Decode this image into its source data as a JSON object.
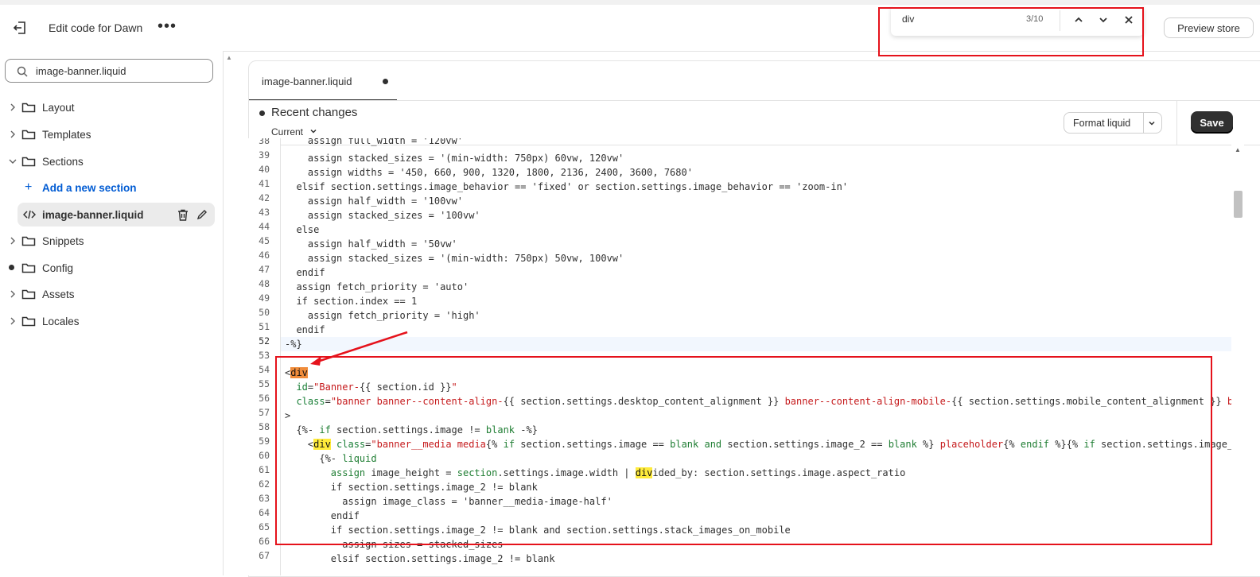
{
  "topbar": {
    "title": "Edit code for Dawn",
    "more_label": "•••",
    "preview_label": "Preview store"
  },
  "find": {
    "query": "div",
    "count": "3/10"
  },
  "sidebar": {
    "search_value": "image-banner.liquid",
    "items": [
      {
        "label": "Layout"
      },
      {
        "label": "Templates"
      },
      {
        "label": "Sections"
      },
      {
        "label": "Add a new section"
      },
      {
        "label": "image-banner.liquid"
      },
      {
        "label": "Snippets"
      },
      {
        "label": "Config"
      },
      {
        "label": "Assets"
      },
      {
        "label": "Locales"
      }
    ]
  },
  "editor": {
    "tab_label": "image-banner.liquid",
    "recent_changes": "Recent changes",
    "current_label": "Current",
    "format_label": "Format liquid",
    "save_label": "Save",
    "line_numbers": [
      "38",
      "39",
      "40",
      "41",
      "42",
      "43",
      "44",
      "45",
      "46",
      "47",
      "48",
      "49",
      "50",
      "51",
      "52",
      "53",
      "54",
      "55",
      "56",
      "57",
      "58",
      "59",
      "60",
      "61",
      "62",
      "63",
      "64",
      "65",
      "66",
      "67"
    ],
    "active_line": "52"
  },
  "colors": {
    "accent": "#005bd3",
    "highlight_box": "#e5121b",
    "current_match": "#f08c3a",
    "match": "#ffeb3b"
  }
}
